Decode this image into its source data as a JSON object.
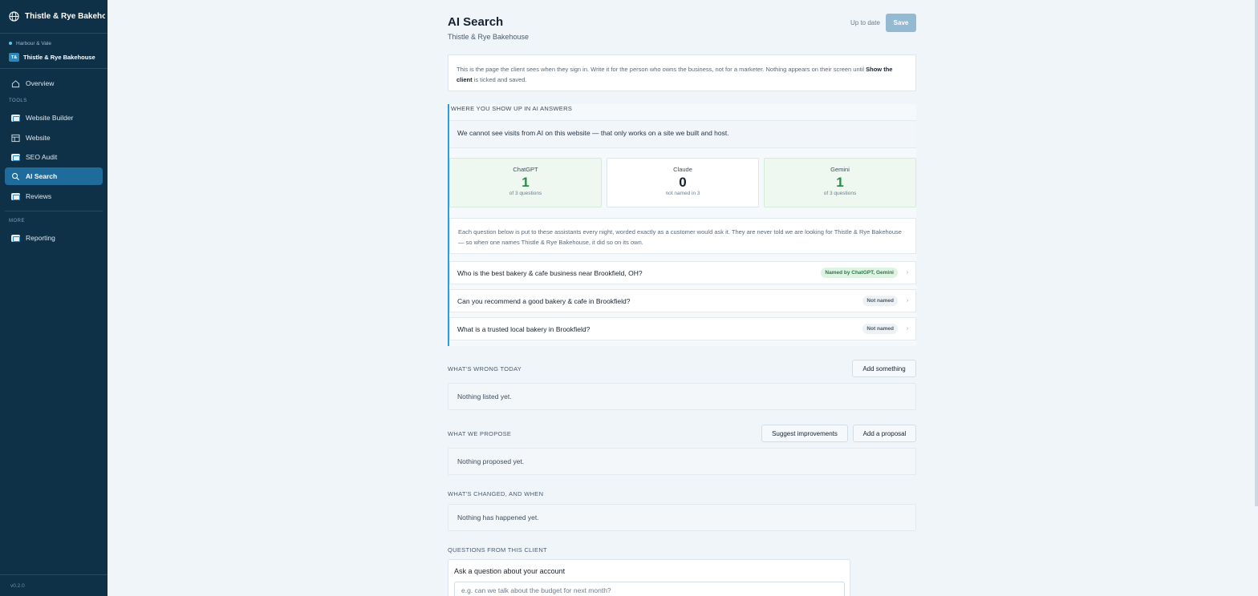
{
  "sidebar": {
    "brand": "Thistle & Rye Bakeho...",
    "agency": "Harbour & Vale",
    "client_tag": "T&",
    "client_name": "Thistle & Rye Bakehouse",
    "overview": "Overview",
    "tools_label": "TOOLS",
    "items": [
      {
        "label": "Website Builder"
      },
      {
        "label": "Website"
      },
      {
        "label": "SEO Audit"
      },
      {
        "label": "AI Search"
      },
      {
        "label": "Reviews"
      }
    ],
    "more_label": "MORE",
    "reporting": "Reporting",
    "version": "v0.2.0",
    "active_item": "AI Search"
  },
  "header": {
    "title": "AI Search",
    "subtitle": "Thistle & Rye Bakehouse",
    "status": "Up to date",
    "save_label": "Save"
  },
  "intro": {
    "text_before": "This is the page the client sees when they sign in. Write it for the person who owns the business, not for a marketer. Nothing appears on their screen until ",
    "bold": "Show the client",
    "text_after": " is ticked and saved."
  },
  "ai_answers": {
    "heading": "WHERE YOU SHOW UP IN AI ANSWERS",
    "notice": "We cannot see visits from AI on this website — that only works on a site we built and host.",
    "stats": [
      {
        "name": "ChatGPT",
        "value": "1",
        "caption": "of 3 questions"
      },
      {
        "name": "Claude",
        "value": "0",
        "caption": "not named in 3"
      },
      {
        "name": "Gemini",
        "value": "1",
        "caption": "of 3 questions"
      }
    ],
    "explain": "Each question below is put to these assistants every night, worded exactly as a customer would ask it. They are never told we are looking for Thistle & Rye Bakehouse — so when one names Thistle & Rye Bakehouse, it did so on its own.",
    "questions": [
      {
        "text": "Who is the best bakery & cafe business near Brookfield, OH?",
        "badge": "Named by ChatGPT, Gemini"
      },
      {
        "text": "Can you recommend a good bakery & cafe in Brookfield?",
        "badge": "Not named"
      },
      {
        "text": "What is a trusted local bakery in Brookfield?",
        "badge": "Not named"
      }
    ]
  },
  "wrong_today": {
    "heading": "WHAT'S WRONG TODAY",
    "add_label": "Add something",
    "empty": "Nothing listed yet."
  },
  "propose": {
    "heading": "WHAT WE PROPOSE",
    "suggest_label": "Suggest improvements",
    "add_label": "Add a proposal",
    "empty": "Nothing proposed yet."
  },
  "changed": {
    "heading": "WHAT'S CHANGED, AND WHEN",
    "empty": "Nothing has happened yet."
  },
  "questions": {
    "heading": "QUESTIONS FROM THIS CLIENT",
    "ask_title": "Ask a question about your account",
    "placeholder": "e.g. can we talk about the budget for next month?"
  },
  "colors": {
    "sidebar_bg": "#0f3147",
    "active_nav": "#1e6b9c",
    "accent_border": "#2a9fd6",
    "positive": "#2e8a46",
    "save_button": "#93b9d3"
  }
}
